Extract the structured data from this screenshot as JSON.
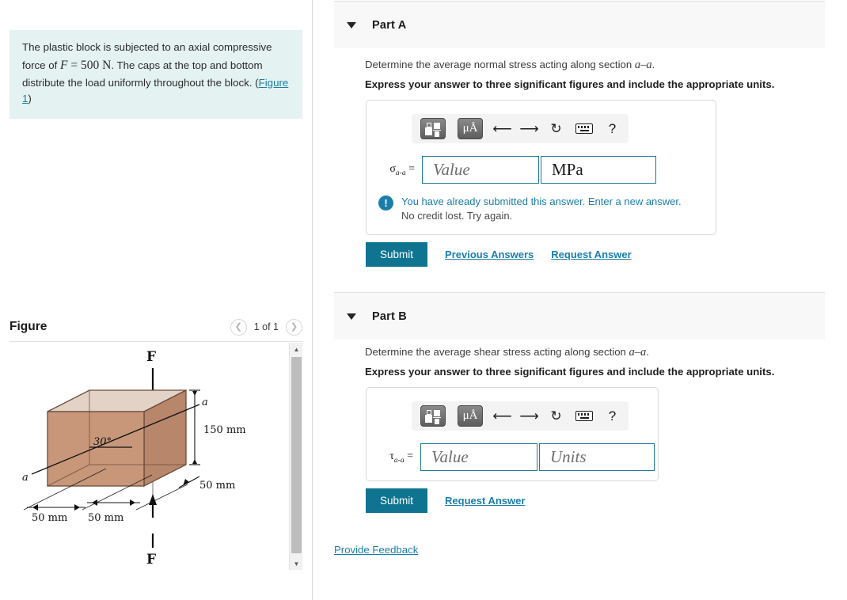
{
  "problem": {
    "text_before_f": "The plastic block is subjected to an axial compressive force of ",
    "f_symbol": "F",
    "equals": " = ",
    "force_value": "500 N",
    "text_after": ". The caps at the top and bottom distribute the load uniformly throughout the block. (",
    "figure_link": "Figure 1",
    "text_end": ")"
  },
  "figure_panel": {
    "title": "Figure",
    "prev_icon": "chevron-left-icon",
    "next_icon": "chevron-right-icon",
    "counter": "1 of 1",
    "scrollbar_up_icon": "caret-up-icon",
    "scrollbar_down_icon": "caret-down-icon"
  },
  "figure_diagram": {
    "force_top_label": "F",
    "force_bottom_label": "F",
    "section_label_right": "a",
    "section_label_left": "a",
    "angle_label": "30°",
    "height_label": "150 mm",
    "depth_label": "50 mm",
    "width_label_left": "50 mm",
    "width_label_right": "50 mm",
    "block_front_color": "#c8977a",
    "block_side_color": "#b7866b",
    "block_top_color": "#e3d2c6",
    "outline_color": "#6b4a3a"
  },
  "toolbar": {
    "template_icon": "math-template-icon",
    "units_icon": "micro-angstrom-units-icon",
    "undo_icon": "undo-arrow-icon",
    "redo_icon": "redo-arrow-icon",
    "reset_icon": "reset-circular-arrow-icon",
    "keyboard_icon": "keyboard-icon",
    "help_icon": "question-mark-icon",
    "help_label": "?",
    "units_label": "μÅ"
  },
  "part_a": {
    "caret_icon": "caret-down-icon",
    "label": "Part A",
    "prompt": "Determine the average normal stress acting along section ",
    "prompt_math": "a–a",
    "prompt_end": ".",
    "instruction": "Express your answer to three significant figures and include the appropriate units.",
    "equation_symbol": "σ",
    "equation_subscript": "a-a",
    "equation_equals": " =",
    "value_placeholder": "Value",
    "units_value": "MPa",
    "alert_line1": "You have already submitted this answer. Enter a new answer.",
    "alert_line2": "No credit lost. Try again.",
    "alert_icon": "exclamation-circle-icon",
    "submit_label": "Submit",
    "previous_answers_label": "Previous Answers",
    "request_answer_label": "Request Answer"
  },
  "part_b": {
    "caret_icon": "caret-down-icon",
    "label": "Part B",
    "prompt": "Determine the average shear stress acting along section ",
    "prompt_math": "a–a",
    "prompt_end": ".",
    "instruction": "Express your answer to three significant figures and include the appropriate units.",
    "equation_symbol": "τ",
    "equation_subscript": "a-a",
    "equation_equals": " =",
    "value_placeholder": "Value",
    "units_placeholder": "Units",
    "submit_label": "Submit",
    "request_answer_label": "Request Answer"
  },
  "footer": {
    "feedback_label": "Provide Feedback"
  },
  "colors": {
    "accent_teal": "#0e7490",
    "link_blue": "#1a7fa8",
    "problem_bg": "#e4f2f1",
    "part_header_bg": "#f8f8f8",
    "input_border": "#1d7a94"
  }
}
